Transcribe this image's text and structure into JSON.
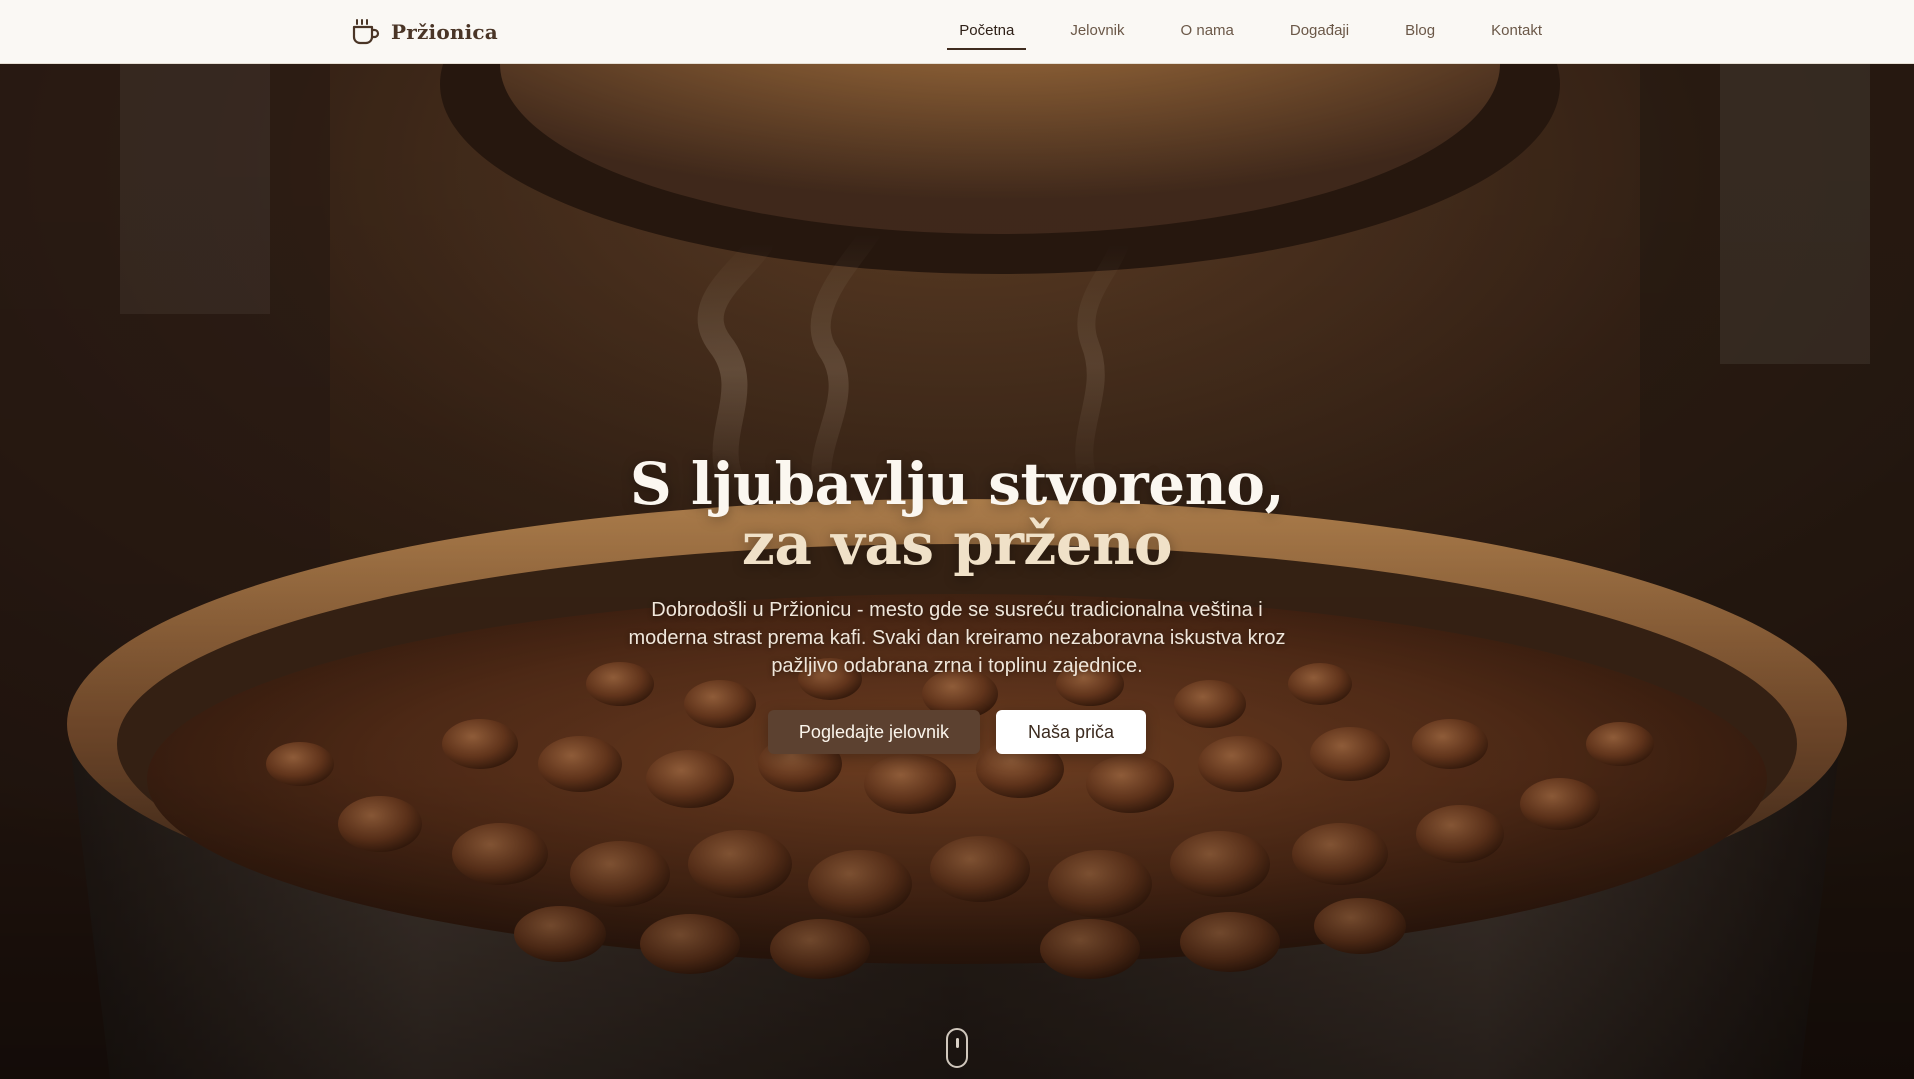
{
  "brand": {
    "name": "Pržionica",
    "icon": "coffee-cup-icon",
    "color": "#4a3526"
  },
  "nav": {
    "items": [
      {
        "label": "Početna",
        "active": true
      },
      {
        "label": "Jelovnik",
        "active": false
      },
      {
        "label": "O nama",
        "active": false
      },
      {
        "label": "Događaji",
        "active": false
      },
      {
        "label": "Blog",
        "active": false
      },
      {
        "label": "Kontakt",
        "active": false
      }
    ]
  },
  "hero": {
    "title_line1": "S ljubavlju stvoreno,",
    "title_line2": "za vas prženo",
    "description": "Dobrodošli u Pržionicu - mesto gde se susreću tradicionalna veština i moderna strast prema kafi. Svaki dan kreiramo nezaboravna iskustva kroz pažljivo odabrana zrna i toplinu zajednice.",
    "primary_button": "Pogledajte jelovnik",
    "secondary_button": "Naša priča",
    "background_image": "coffee-beans-roaster-photo",
    "scroll_icon": "mouse-scroll-icon"
  },
  "colors": {
    "header_bg": "#faf8f4",
    "accent": "#5c4130",
    "title_line2": "#f0e1c8"
  }
}
